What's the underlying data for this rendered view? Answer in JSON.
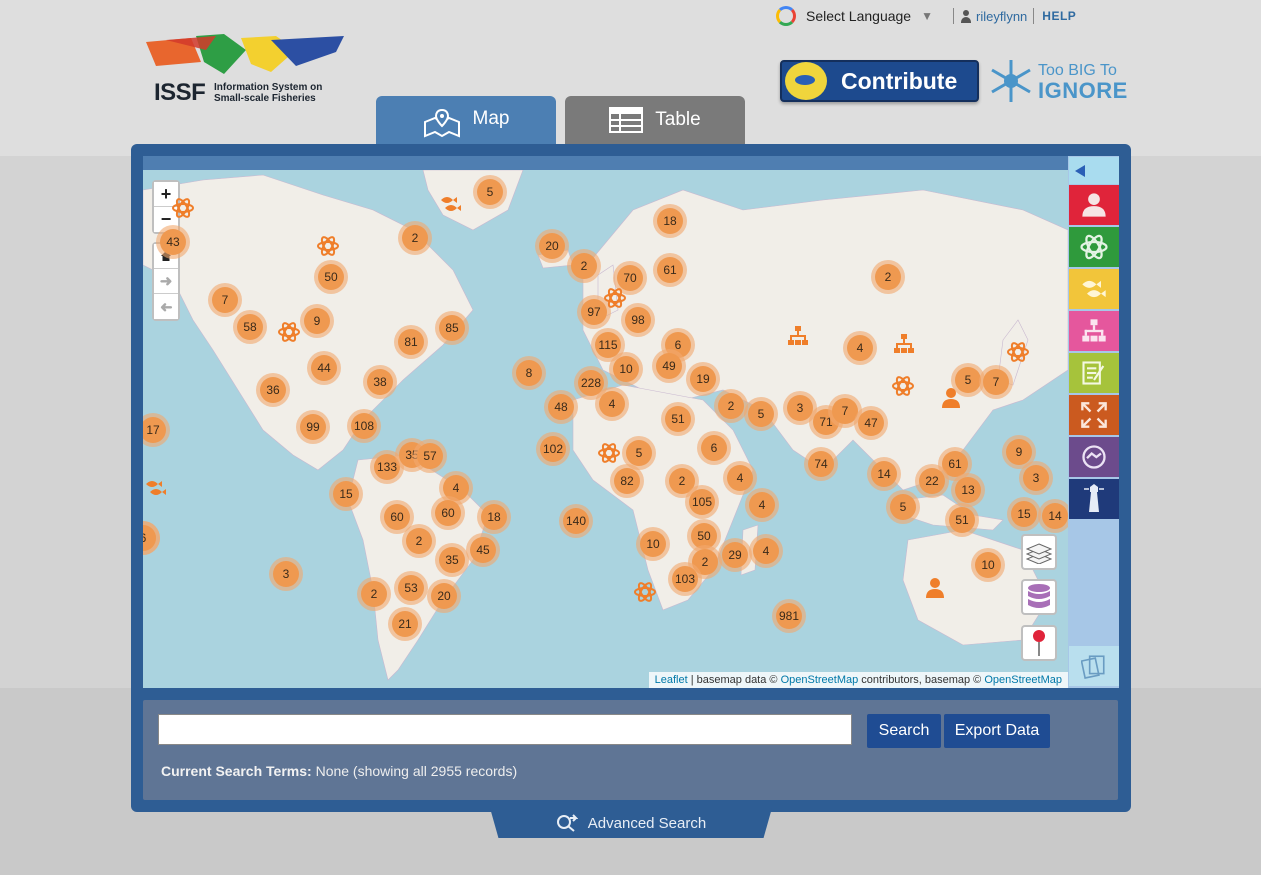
{
  "header": {
    "language_label": "Select Language",
    "language_arrow": "▼",
    "username": "rileyflynn",
    "help": "HELP"
  },
  "logo": {
    "word": "ISSF",
    "sub_line1": "Information System on",
    "sub_line2": "Small-scale Fisheries"
  },
  "contribute_label": "Contribute",
  "tbti": {
    "line1": "Too BIG To",
    "line2": "IGNORE"
  },
  "tabs": [
    {
      "label": "Map",
      "active": true
    },
    {
      "label": "Table",
      "active": false
    }
  ],
  "map": {
    "zoom_in": "+",
    "zoom_out": "−",
    "attribution": {
      "leaflet": "Leaflet",
      "text1": " | basemap data © ",
      "osm1": "OpenStreetMap",
      "text2": " contributors, basemap © ",
      "osm2": "OpenStreetMap"
    },
    "clusters": [
      "5",
      "18",
      "20",
      "2",
      "61",
      "70",
      "2",
      "2",
      "50",
      "43",
      "7",
      "58",
      "9",
      "97",
      "98",
      "115",
      "6",
      "81",
      "85",
      "44",
      "38",
      "4",
      "36",
      "10",
      "49",
      "8",
      "228",
      "19",
      "5",
      "7",
      "17",
      "48",
      "4",
      "2",
      "5",
      "3",
      "71",
      "7",
      "47",
      "99",
      "108",
      "51",
      "102",
      "6",
      "2",
      "133",
      "35",
      "57",
      "5",
      "82",
      "2",
      "4",
      "15",
      "4",
      "105",
      "74",
      "14",
      "61",
      "9",
      "22",
      "13",
      "3",
      "60",
      "60",
      "18",
      "140",
      "4",
      "5",
      "51",
      "15",
      "14",
      "6",
      "2",
      "50",
      "10",
      "45",
      "2",
      "29",
      "4",
      "35",
      "10",
      "3",
      "103",
      "53",
      "20",
      "2",
      "21",
      "981"
    ]
  },
  "sidebar": {
    "buttons": [
      {
        "name": "people",
        "color": "#e0243a"
      },
      {
        "name": "research",
        "color": "#2f9a3c"
      },
      {
        "name": "fish",
        "color": "#f2c53a"
      },
      {
        "name": "organizations",
        "color": "#e5579d"
      },
      {
        "name": "documents",
        "color": "#a6c33b"
      },
      {
        "name": "expand",
        "color": "#cb5a1f"
      },
      {
        "name": "capacity",
        "color": "#6c4b8c"
      },
      {
        "name": "lighthouse",
        "color": "#1f3a7a"
      }
    ]
  },
  "search": {
    "value": "",
    "search_button": "Search",
    "export_button": "Export Data",
    "terms_label": "Current Search Terms:",
    "terms_value": " None (showing all 2955 records)"
  },
  "advanced_search": "Advanced Search"
}
